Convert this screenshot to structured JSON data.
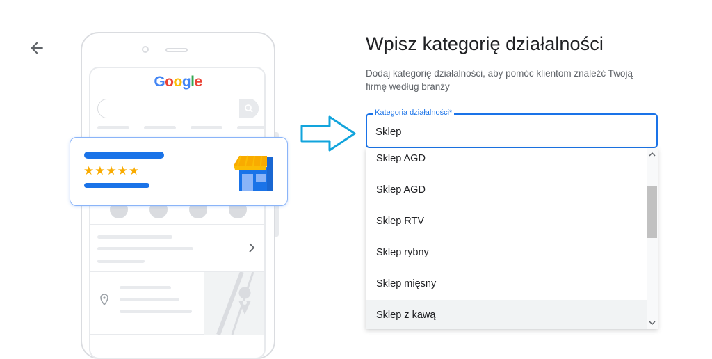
{
  "header": {
    "title": "Wpisz kategorię działalności",
    "subtitle": "Dodaj kategorię działalności, aby pomóc klientom znaleźć Twoją firmę według branży"
  },
  "illustration": {
    "logo_text": "Google",
    "logo_colors": [
      "#4285F4",
      "#EA4335",
      "#FBBC05",
      "#4285F4",
      "#34A853",
      "#EA4335"
    ],
    "rating_stars": "★★★★★",
    "accent": "#1a73e8",
    "star_color": "#f9ab00"
  },
  "category_field": {
    "label": "Kategoria działalności*",
    "value": "Sklep"
  },
  "dropdown": {
    "options": [
      "Sklep AGD",
      "Sklep AGD",
      "Sklep RTV",
      "Sklep rybny",
      "Sklep mięsny",
      "Sklep z kawą"
    ],
    "highlighted_index": 5
  }
}
